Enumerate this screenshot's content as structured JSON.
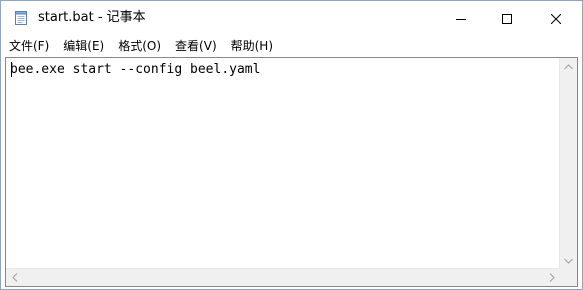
{
  "window": {
    "title": "start.bat - 记事本"
  },
  "menu": {
    "items": [
      {
        "label": "文件(F)"
      },
      {
        "label": "编辑(E)"
      },
      {
        "label": "格式(O)"
      },
      {
        "label": "查看(V)"
      },
      {
        "label": "帮助(H)"
      }
    ]
  },
  "editor": {
    "content": "bee.exe start --config beel.yaml"
  },
  "icons": {
    "app": "notepad-icon",
    "minimize": "minimize-icon",
    "maximize": "maximize-icon",
    "close": "close-icon"
  }
}
